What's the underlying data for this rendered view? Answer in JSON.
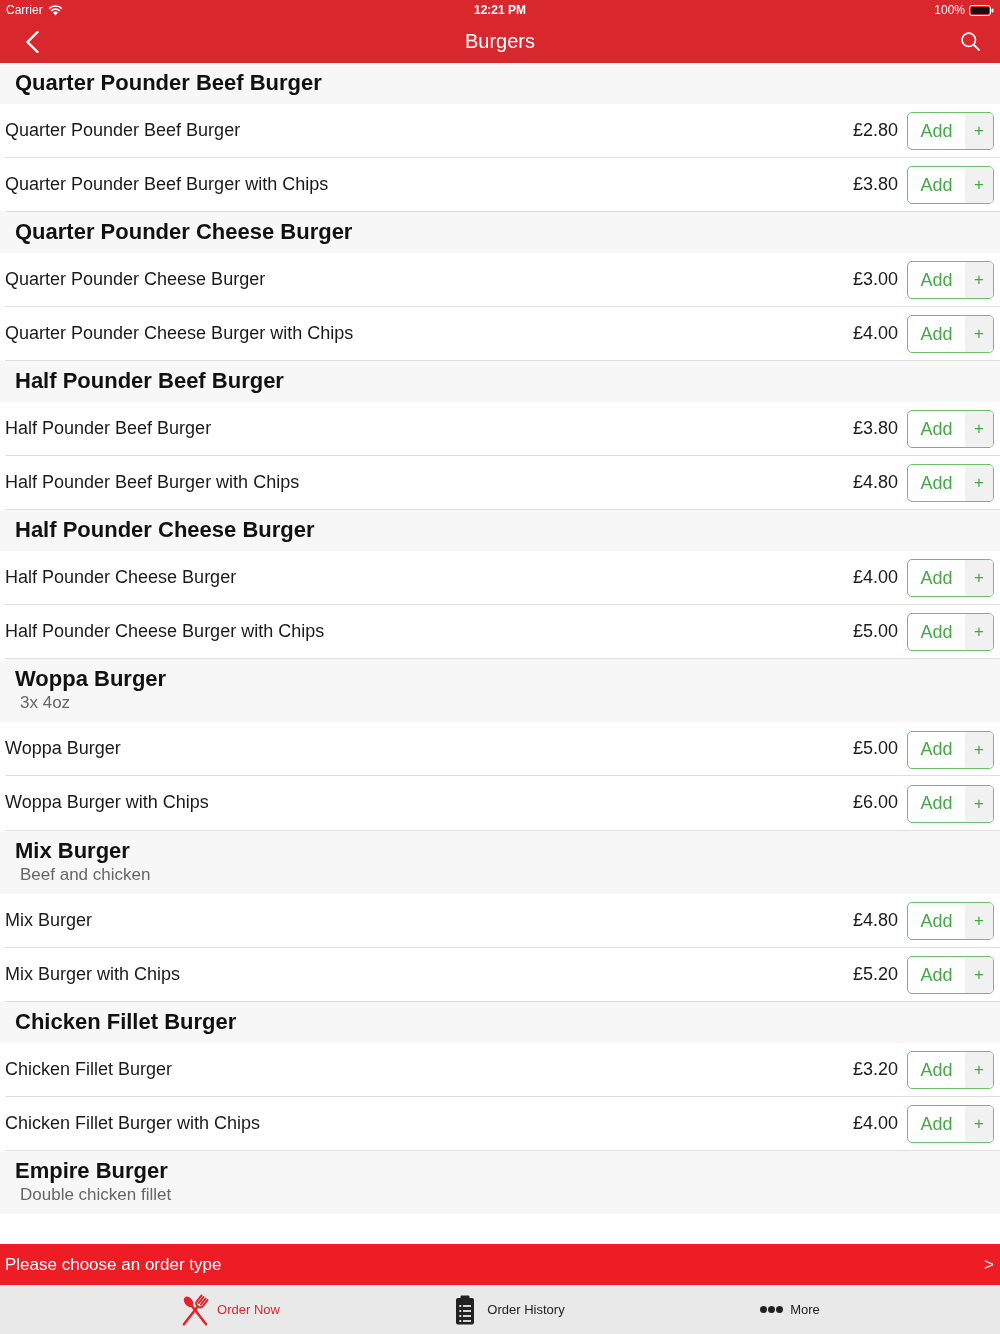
{
  "status_bar": {
    "carrier": "Carrier",
    "time": "12:21 PM",
    "battery": "100%"
  },
  "nav_bar": {
    "title": "Burgers"
  },
  "sections": [
    {
      "title": "Quarter Pounder Beef Burger",
      "items": [
        {
          "name": "Quarter Pounder Beef Burger",
          "price": "£2.80",
          "add_label": "Add",
          "plus_label": "+"
        },
        {
          "name": "Quarter Pounder Beef Burger with Chips",
          "price": "£3.80",
          "add_label": "Add",
          "plus_label": "+"
        }
      ]
    },
    {
      "title": "Quarter Pounder Cheese Burger",
      "items": [
        {
          "name": "Quarter Pounder Cheese Burger",
          "price": "£3.00",
          "add_label": "Add",
          "plus_label": "+"
        },
        {
          "name": "Quarter Pounder Cheese Burger with Chips",
          "price": "£4.00",
          "add_label": "Add",
          "plus_label": "+"
        }
      ]
    },
    {
      "title": "Half Pounder Beef Burger",
      "items": [
        {
          "name": "Half Pounder Beef Burger",
          "price": "£3.80",
          "add_label": "Add",
          "plus_label": "+"
        },
        {
          "name": "Half Pounder Beef Burger with Chips",
          "price": "£4.80",
          "add_label": "Add",
          "plus_label": "+"
        }
      ]
    },
    {
      "title": "Half Pounder Cheese Burger",
      "items": [
        {
          "name": "Half Pounder Cheese Burger",
          "price": "£4.00",
          "add_label": "Add",
          "plus_label": "+"
        },
        {
          "name": "Half Pounder Cheese Burger with Chips",
          "price": "£5.00",
          "add_label": "Add",
          "plus_label": "+"
        }
      ]
    },
    {
      "title": "Woppa Burger",
      "subtitle": "3x 4oz",
      "items": [
        {
          "name": "Woppa Burger",
          "price": "£5.00",
          "add_label": "Add",
          "plus_label": "+"
        },
        {
          "name": "Woppa Burger with Chips",
          "price": "£6.00",
          "add_label": "Add",
          "plus_label": "+"
        }
      ]
    },
    {
      "title": "Mix Burger",
      "subtitle": "Beef and chicken",
      "items": [
        {
          "name": "Mix Burger",
          "price": "£4.80",
          "add_label": "Add",
          "plus_label": "+"
        },
        {
          "name": "Mix Burger with Chips",
          "price": "£5.20",
          "add_label": "Add",
          "plus_label": "+"
        }
      ]
    },
    {
      "title": "Chicken Fillet Burger",
      "items": [
        {
          "name": "Chicken Fillet Burger",
          "price": "£3.20",
          "add_label": "Add",
          "plus_label": "+"
        },
        {
          "name": "Chicken Fillet Burger with Chips",
          "price": "£4.00",
          "add_label": "Add",
          "plus_label": "+"
        }
      ]
    },
    {
      "title": "Empire Burger",
      "subtitle": "Double chicken fillet"
    }
  ],
  "order_banner": {
    "text": "Please choose an order type",
    "arrow": ">"
  },
  "tab_bar": {
    "tabs": [
      {
        "label": "Order Now",
        "selected": true
      },
      {
        "label": "Order History",
        "selected": false
      },
      {
        "label": "More",
        "selected": false
      }
    ]
  }
}
